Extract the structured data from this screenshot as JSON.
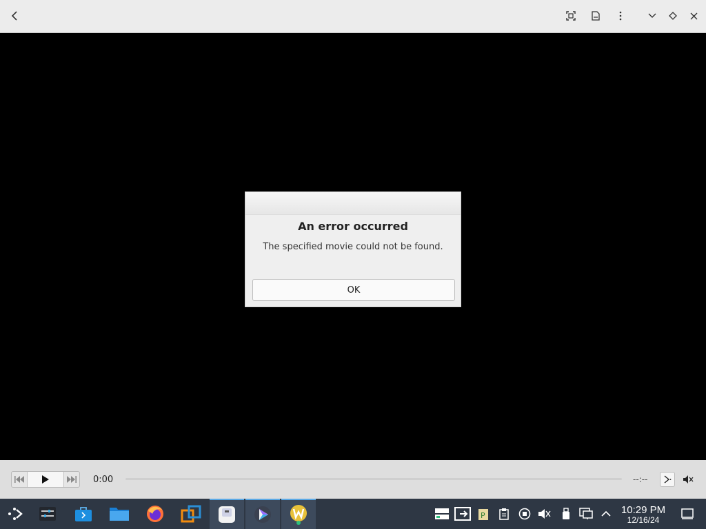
{
  "window": {
    "buttons": [
      "back-icon",
      "fullscreen-icon",
      "document-icon",
      "kebab-menu-icon",
      "chevron-down-icon",
      "diamond-icon",
      "close-icon"
    ]
  },
  "dialog": {
    "heading": "An error occurred",
    "message": "The specified movie could not be found.",
    "ok_label": "OK"
  },
  "player": {
    "current_time": "0:00",
    "remaining_time": "--:--",
    "seek_progress": 0
  },
  "taskbar": {
    "apps": [
      {
        "name": "app-launcher"
      },
      {
        "name": "system-settings"
      },
      {
        "name": "software-store"
      },
      {
        "name": "file-manager"
      },
      {
        "name": "firefox"
      },
      {
        "name": "virtualization"
      },
      {
        "name": "text-editor"
      },
      {
        "name": "media-player"
      },
      {
        "name": "w-app"
      }
    ],
    "clock_time": "10:29 PM",
    "clock_date": "12/16/24"
  },
  "colors": {
    "titlebar": "#ececec",
    "video_bg": "#000000",
    "controls_bg": "#dedede",
    "taskbar_bg": "#2e3744",
    "accent": "#5aa9e6"
  }
}
